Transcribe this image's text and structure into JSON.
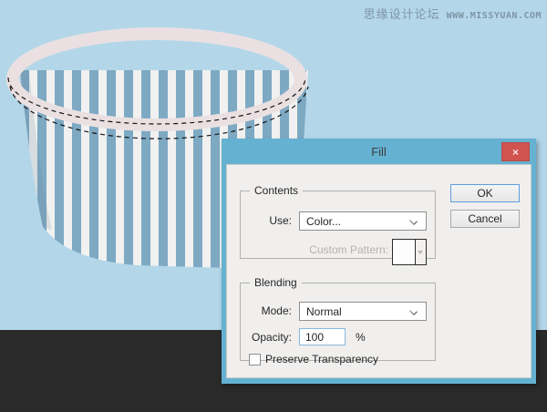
{
  "watermark": {
    "site_name_cn": "思缘设计论坛",
    "site_url": "WWW.MISSYUAN.COM"
  },
  "dialog": {
    "title": "Fill",
    "close_glyph": "×",
    "ok_label": "OK",
    "cancel_label": "Cancel",
    "contents": {
      "legend": "Contents",
      "use_label": "Use:",
      "use_value": "Color...",
      "custom_pattern_label": "Custom Pattern:"
    },
    "blending": {
      "legend": "Blending",
      "mode_label": "Mode:",
      "mode_value": "Normal",
      "opacity_label": "Opacity:",
      "opacity_value": "100",
      "opacity_unit": "%",
      "preserve_label": "Preserve Transparency",
      "preserve_checked": false
    }
  },
  "colors": {
    "canvas_bg": "#b3d7e9",
    "stripe_blue": "#7ea9c3",
    "stripe_white": "#f0f1f0",
    "rim_color": "#eae0e1",
    "titlebar_blue": "#65b1d2",
    "close_red": "#d05350",
    "dialog_bg": "#f0efee",
    "workspace_dark": "#2a2a2b",
    "watermark_color": "#7e95a5"
  }
}
